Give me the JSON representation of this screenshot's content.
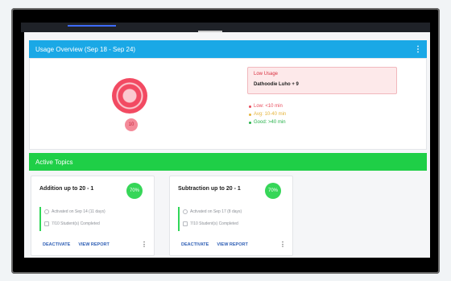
{
  "overview": {
    "header": "Usage Overview (Sep 18 - Sep 24)",
    "ring_count": "10",
    "alert_title": "Low Usage",
    "alert_body": "Dathoodie Luho + 9",
    "legend": [
      {
        "label": "Low: <10 min",
        "color": "#e84b5b"
      },
      {
        "label": "Avg: 10-40 min",
        "color": "#e5b53d"
      },
      {
        "label": "Good: >40 min",
        "color": "#27b24b"
      }
    ]
  },
  "topics": {
    "header": "Active Topics",
    "cards": [
      {
        "title": "Addition up to 20 - 1",
        "percent": "70%",
        "activated": "Activated on Sep 14 (11 days)",
        "completed": "7/10 Student(s) Completed",
        "deactivate": "DEACTIVATE",
        "report": "VIEW REPORT"
      },
      {
        "title": "Subtraction up to 20 - 1",
        "percent": "70%",
        "activated": "Activated on Sep 17 (8 days)",
        "completed": "7/10 Student(s) Completed",
        "deactivate": "DEACTIVATE",
        "report": "VIEW REPORT"
      }
    ]
  },
  "colors": {
    "overview_bar": "#1aa8e6",
    "topics_bar": "#1fcf47",
    "accent_green": "#36d658",
    "ring_red": "#f24a62"
  }
}
